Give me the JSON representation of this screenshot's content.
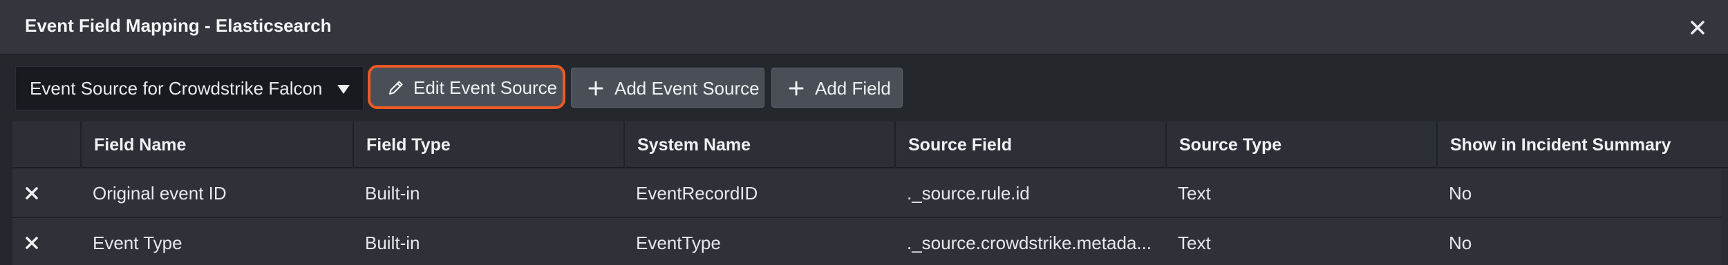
{
  "dialog": {
    "title": "Event Field Mapping - Elasticsearch",
    "close_icon": "close-icon"
  },
  "toolbar": {
    "event_source_select": "Event Source for Crowdstrike Falcon",
    "edit_event_source_label": "Edit Event Source",
    "add_event_source_label": "Add Event Source",
    "add_field_label": "Add Field",
    "highlight_color": "#ee5a24"
  },
  "table": {
    "headers": [
      "Field Name",
      "Field Type",
      "System Name",
      "Source Field",
      "Source Type",
      "Show in Incident Summary"
    ],
    "rows": [
      {
        "field_name": "Original event ID",
        "field_type": "Built-in",
        "system_name": "EventRecordID",
        "source_field": "._source.rule.id",
        "source_type": "Text",
        "show_in_summary": "No"
      },
      {
        "field_name": "Event Type",
        "field_type": "Built-in",
        "system_name": "EventType",
        "source_field": "._source.crowdstrike.metada...",
        "source_type": "Text",
        "show_in_summary": "No"
      }
    ]
  }
}
